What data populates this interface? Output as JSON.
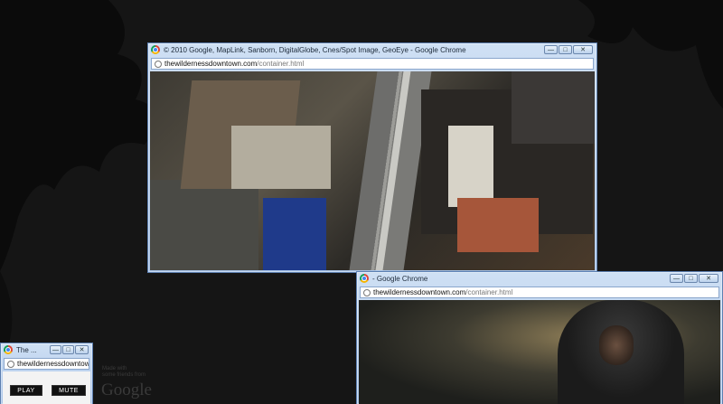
{
  "windows": {
    "map": {
      "title": "© 2010 Google, MapLink, Sanborn, DigitalGlobe, Cnes/Spot Image, GeoEye - Google Chrome",
      "url_domain": "thewildernessdowntown.com",
      "url_path": "/container.html"
    },
    "video": {
      "title": "- Google Chrome",
      "url_domain": "thewildernessdowntown.com",
      "url_path": "/container.html"
    },
    "controls": {
      "title": "The ...",
      "url_domain": "thewildernessdowntown",
      "play_label": "PLAY",
      "mute_label": "MUTE"
    }
  },
  "window_buttons": {
    "minimize": "—",
    "maximize": "□",
    "close": "✕"
  },
  "background": {
    "made_with_line1": "Made with",
    "made_with_line2": "some friends from",
    "brand": "Google"
  }
}
